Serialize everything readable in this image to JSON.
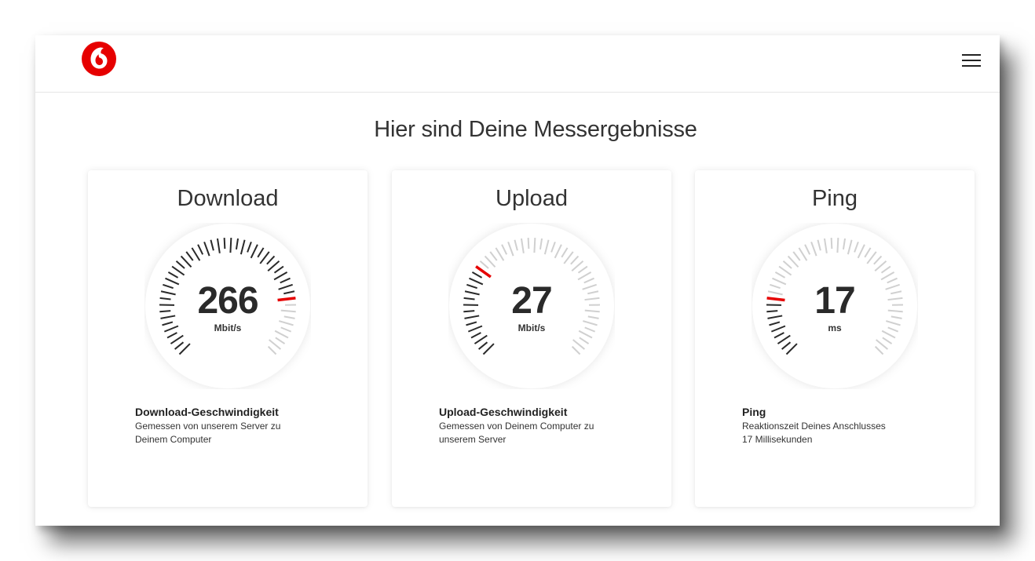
{
  "header": {
    "logo_icon": "vodafone-logo",
    "menu_icon": "hamburger-menu-icon"
  },
  "page": {
    "title": "Hier sind Deine Messergebnisse"
  },
  "colors": {
    "accent": "#e60000",
    "tick_active": "#2a2a2a",
    "tick_inactive": "#d0d0d0"
  },
  "cards": [
    {
      "title": "Download",
      "value": "266",
      "unit": "Mbit/s",
      "gauge_fraction": 0.8,
      "info_title": "Download-Geschwindigkeit",
      "info_line1": "Gemessen von unserem Server zu",
      "info_line2": "Deinem Computer"
    },
    {
      "title": "Upload",
      "value": "27",
      "unit": "Mbit/s",
      "gauge_fraction": 0.29,
      "info_title": "Upload-Geschwindigkeit",
      "info_line1": "Gemessen von Deinem Computer zu",
      "info_line2": "unserem Server"
    },
    {
      "title": "Ping",
      "value": "17",
      "unit": "ms",
      "gauge_fraction": 0.2,
      "info_title": "Ping",
      "info_line1": "Reaktionszeit Deines Anschlusses",
      "info_line2": "17 Millisekunden"
    }
  ]
}
